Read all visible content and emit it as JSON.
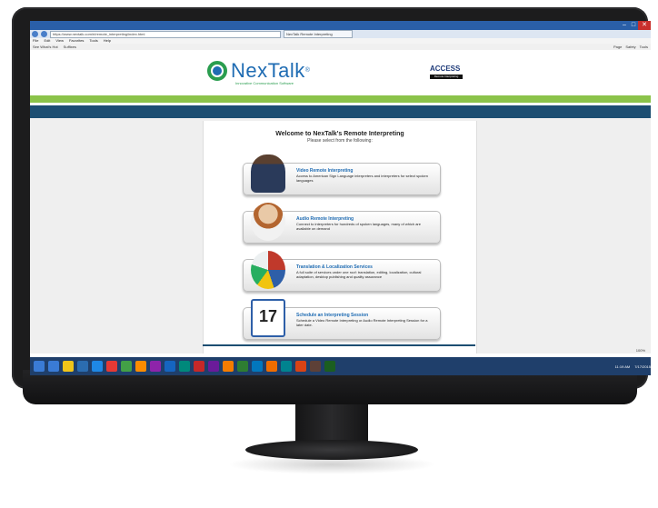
{
  "browser": {
    "url": "https://www.nextalk.com/ri/remote_interpreting/index.html",
    "tab_title": "NexTalk Remote Interpreting",
    "menu": [
      "File",
      "Edit",
      "View",
      "Favorites",
      "Tools",
      "Help"
    ],
    "favorites": [
      "See What's Hot",
      "Suffixes"
    ],
    "commands": [
      "Page",
      "Safety",
      "Tools"
    ]
  },
  "header": {
    "logo_text": "NexTalk",
    "logo_registered": "®",
    "tagline": "Innovative Communication Software",
    "access_text": "ACCESS",
    "access_sub": "Remote Interpreting"
  },
  "main": {
    "welcome": "Welcome to NexTalk's Remote Interpreting",
    "subtitle": "Please select from the following:",
    "services": [
      {
        "title": "Video Remote Interpreting",
        "desc": "Access to American Sign Language interpreters and interpreters for select spoken languages",
        "icon": "sign-language-interpreter-photo"
      },
      {
        "title": "Audio Remote Interpreting",
        "desc": "Connect to interpreters for hundreds of spoken languages, many of which are available on demand",
        "icon": "headset-operator-photo"
      },
      {
        "title": "Translation & Localization Services",
        "desc": "A full suite of services under one roof: translation, editing, localization, cultural adaptation, desktop publishing and quality assurance",
        "icon": "flag-globe-photo"
      },
      {
        "title": "Schedule an Interpreting Session",
        "desc": "Schedule a Video Remote Interpreting or Audio Remote Interpreting Session for a later date.",
        "icon": "calendar-icon",
        "calendar_day": "17"
      }
    ]
  },
  "status": {
    "zoom": "100%"
  },
  "taskbar": {
    "icon_colors": [
      "#3a7bd5",
      "#f0c419",
      "#2b6cb0",
      "#1e88e5",
      "#e53935",
      "#43a047",
      "#fb8c00",
      "#8e24aa",
      "#1565c0",
      "#00897b",
      "#c62828",
      "#6a1b9a",
      "#f57c00",
      "#2e7d32",
      "#0277bd",
      "#ef6c00",
      "#00838f",
      "#d84315",
      "#5d4037",
      "#1b5e20"
    ],
    "time": "11:19 AM",
    "date": "7/17/2015"
  }
}
